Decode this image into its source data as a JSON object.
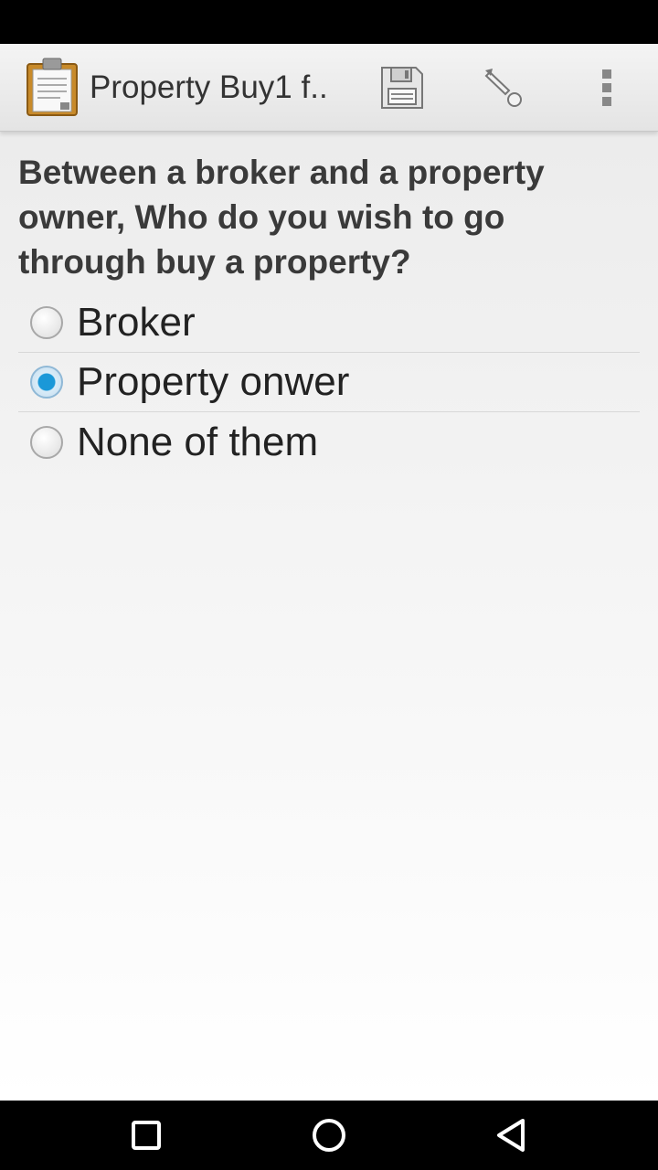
{
  "app_bar": {
    "title": "Property Buy1 f..",
    "icons": [
      "clipboard-icon",
      "save-icon",
      "go-to-icon",
      "overflow-menu-icon"
    ]
  },
  "form": {
    "question": "Between a broker and a property owner, Who do you wish to go through buy a property?",
    "options": [
      {
        "label": "Broker",
        "selected": false
      },
      {
        "label": "Property onwer",
        "selected": true
      },
      {
        "label": "None of them",
        "selected": false
      }
    ]
  },
  "navigation": {
    "icons": [
      "recents-icon",
      "home-icon",
      "back-icon"
    ]
  },
  "colors": {
    "accent": "#1a98d8",
    "action_bar": "#ececec",
    "system_bars": "#000000"
  }
}
